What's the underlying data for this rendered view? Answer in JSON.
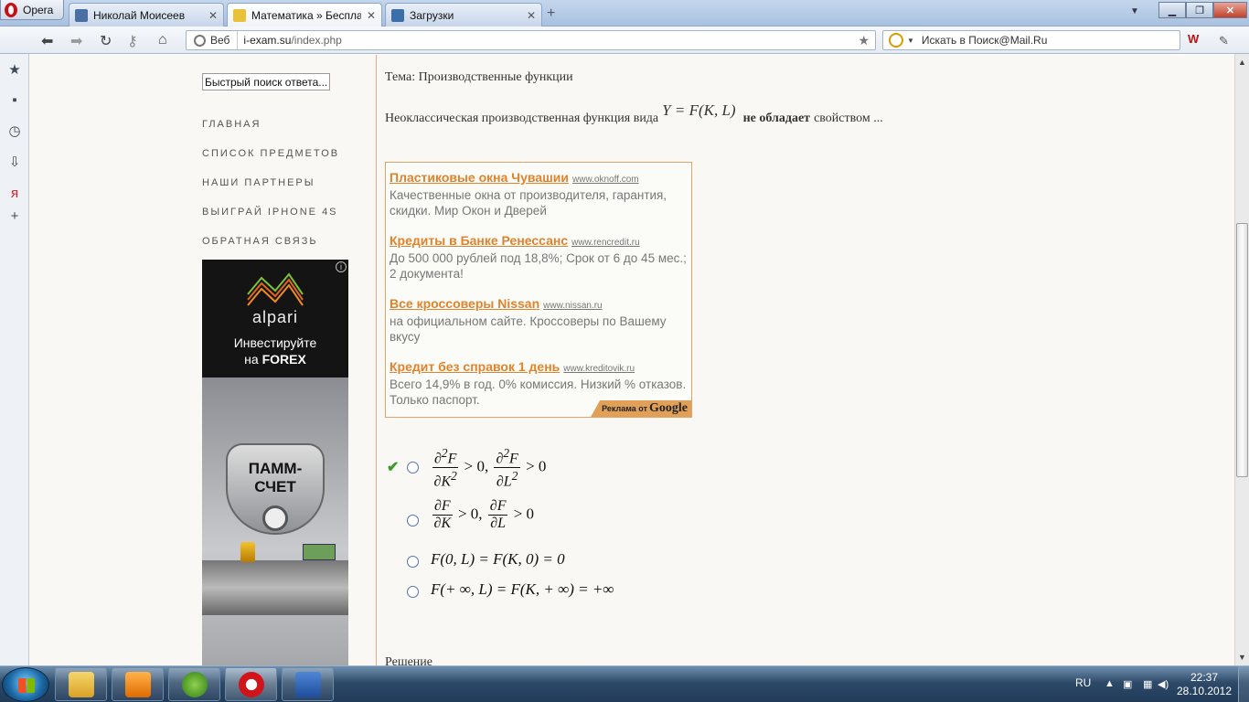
{
  "browser": {
    "menu_label": "Opera",
    "tabs": [
      {
        "label": "Николай Моисеев",
        "close": "✕"
      },
      {
        "label": "Математика » Бесплат...",
        "close": "✕"
      },
      {
        "label": "Загрузки",
        "close": "✕"
      }
    ],
    "new_tab": "+",
    "address": {
      "scheme_label": "Веб",
      "url_host": "i-exam.su",
      "url_path": "/index.php"
    },
    "search_placeholder": "Искать в Поиск@Mail.Ru",
    "window_buttons": {
      "minimize": "▁",
      "maximize": "❐",
      "close": "✕"
    }
  },
  "sidebar_nav": {
    "quick_search": "Быстрый поиск ответа...",
    "links": [
      "ГЛАВНАЯ",
      "СПИСОК ПРЕДМЕТОВ",
      "НАШИ ПАРТНЕРЫ",
      "ВЫИГРАЙ IPHONE 4S",
      "ОБРАТНАЯ СВЯЗЬ"
    ]
  },
  "banner": {
    "brand": "alpari",
    "line1": "Инвестируйте",
    "line2_prefix": "на ",
    "line2_bold": "FOREX",
    "shield_line1": "ПАММ-",
    "shield_line2": "СЧЕТ",
    "info": "i"
  },
  "main": {
    "topic": "Тема: Производственные функции",
    "question_prefix": "Неоклассическая производственная функция вида",
    "question_formula": "Y = F(K, L)",
    "question_bold": "не обладает",
    "question_suffix": "свойством ...",
    "solution_label": "Решение"
  },
  "ads": [
    {
      "title": "Пластиковые окна Чувашии",
      "url": "www.oknoff.com",
      "text": "Качественные окна от производителя, гарантия, скидки. Мир Окон и Дверей"
    },
    {
      "title": "Кредиты в Банке Ренессанс",
      "url": "www.rencredit.ru",
      "text": "До 500 000 рублей под 18,8%; Срок от 6 до 45 мес.; 2 документа!"
    },
    {
      "title": "Все кроссоверы Nissan",
      "url": "www.nissan.ru",
      "text": "на официальном сайте. Кроссоверы по Вашему вкусу"
    },
    {
      "title": "Кредит без справок 1 день",
      "url": "www.kreditovik.ru",
      "text": "Всего 14,9% в год. 0% комиссия. Низкий % отказов. Только паспорт."
    }
  ],
  "ads_by": {
    "prefix": "Реклама от",
    "brand": "Google"
  },
  "options": [
    {
      "text": "∂²F/∂K² > 0, ∂²F/∂L² > 0",
      "correct": true
    },
    {
      "text": "∂F/∂K > 0, ∂F/∂L > 0",
      "correct": false
    },
    {
      "text": "F(0, L) = F(K, 0) = 0",
      "correct": false
    },
    {
      "text": "F(+ ∞, L) = F(K, + ∞) = +∞",
      "correct": false
    }
  ],
  "taskbar": {
    "language": "RU",
    "time": "22:37",
    "date": "28.10.2012"
  },
  "colors": {
    "ad_title": "#e0832c",
    "accent_line": "#e2a98a",
    "check": "#3a9a2a"
  }
}
